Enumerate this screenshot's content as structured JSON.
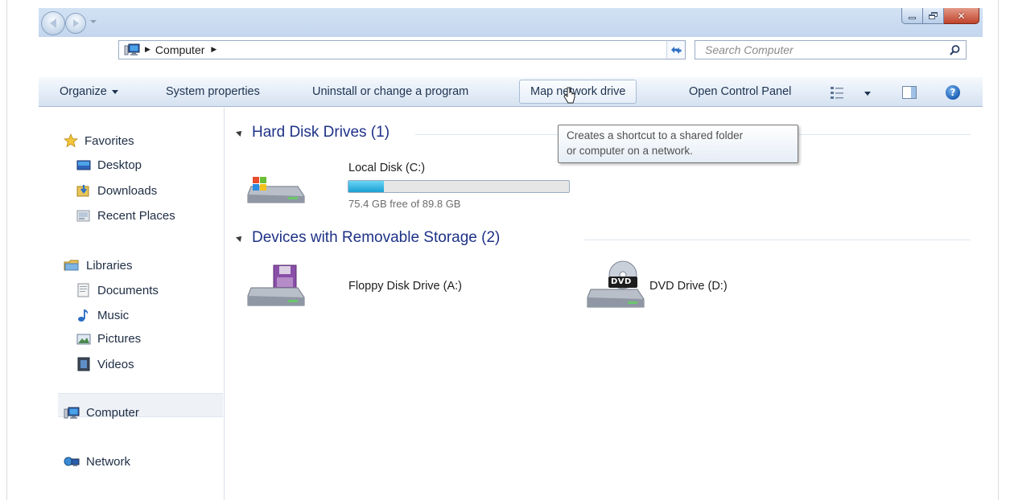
{
  "window": {
    "controls": {
      "minimize_icon": "minimize-icon",
      "maximize_icon": "restore-icon",
      "close_icon": "close-icon",
      "close_glyph": "✕"
    }
  },
  "address_bar": {
    "location": "Computer",
    "breadcrumb_separator": "▶",
    "icon": "computer-icon"
  },
  "search": {
    "placeholder": "Search Computer",
    "icon": "search-icon"
  },
  "toolbar": {
    "organize_label": "Organize",
    "system_properties_label": "System properties",
    "uninstall_label": "Uninstall or change a program",
    "map_drive_label": "Map network drive",
    "control_panel_label": "Open Control Panel",
    "views_icon": "views-icon",
    "preview_icon": "preview-pane-icon",
    "help_icon": "help-icon",
    "help_glyph": "?"
  },
  "tooltip": {
    "line1": "Creates a shortcut to a shared folder",
    "line2": "or computer on a network."
  },
  "nav": {
    "favorites": {
      "label": "Favorites",
      "items": [
        {
          "label": "Desktop"
        },
        {
          "label": "Downloads"
        },
        {
          "label": "Recent Places"
        }
      ]
    },
    "libraries": {
      "label": "Libraries",
      "items": [
        {
          "label": "Documents"
        },
        {
          "label": "Music"
        },
        {
          "label": "Pictures"
        },
        {
          "label": "Videos"
        }
      ]
    },
    "computer": {
      "label": "Computer",
      "selected": true
    },
    "network": {
      "label": "Network"
    }
  },
  "groups": {
    "hard_disks": {
      "header": "Hard Disk Drives (1)",
      "drives": [
        {
          "name": "Local Disk (C:)",
          "free_text": "75.4 GB free of 89.8 GB",
          "used_fraction": 0.16
        }
      ]
    },
    "removable": {
      "header": "Devices with Removable Storage (2)",
      "drives": [
        {
          "name": "Floppy Disk Drive (A:)"
        },
        {
          "name": "DVD Drive (D:)",
          "badge": "DVD"
        }
      ]
    }
  },
  "colors": {
    "group_header": "#1e3287",
    "capacity_fill": "#1a9fd3",
    "toolbar_text": "#1e3350"
  }
}
